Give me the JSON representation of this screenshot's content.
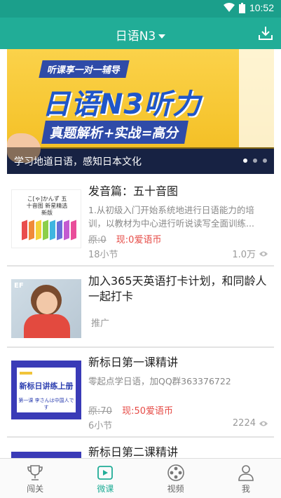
{
  "status_bar": {
    "time": "10:52"
  },
  "app_bar": {
    "title": "日语N3"
  },
  "banner": {
    "tagline": "听课享一对一辅导",
    "headline": "日语N3听力",
    "subline": "真题解析+实战=高分",
    "caption": "学习地道日语，感知日本文化"
  },
  "courses": [
    {
      "title": "发音篇：五十音图",
      "description": "1.从初级入门开始系统地进行日语能力的培训，以教材为中心进行听说读写全面训练...",
      "original_price": "原:0",
      "current_price": "现:0爱语币",
      "lessons": "18小节",
      "views": "1.0万",
      "thumb_text": "こ[ゃ]かんず 五十音图 新星精选新版"
    },
    {
      "title": "加入365天英语打卡计划，和同龄人一起打卡",
      "tag": "推广",
      "thumb_logo": "EF"
    },
    {
      "title": "新标日第一课精讲",
      "description": "零起点学日语，加QQ群363376722",
      "original_price": "原:70",
      "current_price": "现:50爱语币",
      "lessons": "6小节",
      "views": "2224",
      "thumb_text": "新标日讲练上册",
      "thumb_sub": "第一课 李さんは中国人です"
    },
    {
      "title": "新标日第二课精讲"
    }
  ],
  "bottom_nav": [
    {
      "label": "闯关",
      "icon": "trophy-icon"
    },
    {
      "label": "微课",
      "icon": "play-icon"
    },
    {
      "label": "视频",
      "icon": "film-reel-icon"
    },
    {
      "label": "我",
      "icon": "person-icon"
    }
  ],
  "colors": {
    "primary": "#21ad97",
    "price_red": "#e64b46"
  }
}
